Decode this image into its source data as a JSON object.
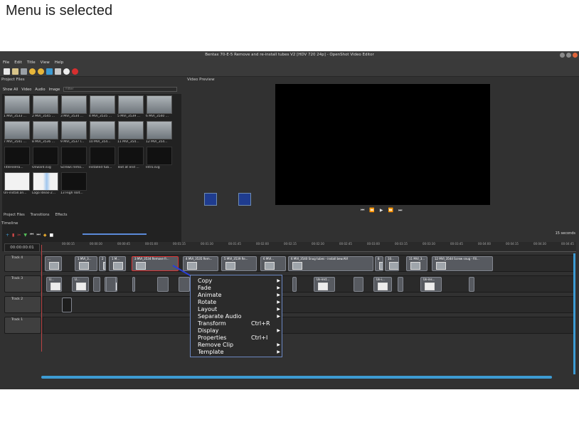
{
  "caption": "Menu is selected",
  "window": {
    "title": "Bentax 70-E-5 Remove and re-install tubes V2 [HDV 720 24p] - OpenShot Video Editor"
  },
  "menu": [
    "File",
    "Edit",
    "Title",
    "View",
    "Help"
  ],
  "panels": {
    "project_files": "Project Files",
    "video_preview": "Video Preview",
    "timeline": "Timeline"
  },
  "filters": [
    "Show All",
    "Video",
    "Audio",
    "Image"
  ],
  "filter_placeholder": "Filter",
  "files": [
    {
      "label": "1 MVI_3533 ...",
      "kind": "gray"
    },
    {
      "label": "2 MVI_3545 ...",
      "kind": "gray"
    },
    {
      "label": "3 MVI_3534 ...",
      "kind": "gray"
    },
    {
      "label": "4 MVI_3535 ...",
      "kind": "gray"
    },
    {
      "label": "5 MVI_3539 ...",
      "kind": "gray"
    },
    {
      "label": "6 MVI_3540 ...",
      "kind": "gray"
    },
    {
      "label": "7 MVI_3541 ...",
      "kind": "gray"
    },
    {
      "label": "8 MVI_3536 ...",
      "kind": "gray"
    },
    {
      "label": "9 MVI_3537 l...",
      "kind": "gray"
    },
    {
      "label": "10 MVI_354...",
      "kind": "gray"
    },
    {
      "label": "11 MVI_354...",
      "kind": "gray"
    },
    {
      "label": "12 MVI_354...",
      "kind": "gray"
    },
    {
      "label": "TitleFileHa...",
      "kind": "dark"
    },
    {
      "label": "Onward.svg",
      "kind": "dark"
    },
    {
      "label": "Screws remo...",
      "kind": "dark"
    },
    {
      "label": "Installed tub...",
      "kind": "dark"
    },
    {
      "label": "Text at end ...",
      "kind": "dark"
    },
    {
      "label": "Intro.svg",
      "kind": "dark"
    },
    {
      "label": "Un-install.an...",
      "kind": "white"
    },
    {
      "label": "Logo Ideas-2...",
      "kind": "blue"
    },
    {
      "label": "13 High Volt...",
      "kind": "dark"
    }
  ],
  "bottom_tabs": [
    "Project Files",
    "Transitions",
    "Effects"
  ],
  "transport": [
    "⏮",
    "⏪",
    "▶",
    "⏩",
    "⏭"
  ],
  "timeline": {
    "timecode": "00:00:00:01",
    "zoom_label": "15 seconds",
    "ticks": [
      "00:00:15",
      "00:00:30",
      "00:00:45",
      "00:01:00",
      "00:01:15",
      "00:01:30",
      "00:01:45",
      "00:02:00",
      "00:02:15",
      "00:02:30",
      "00:02:45",
      "00:03:00",
      "00:03:15",
      "00:03:30",
      "00:03:45",
      "00:04:00",
      "00:04:15",
      "00:04:30",
      "00:04:45"
    ],
    "tracks": [
      "Track 4",
      "Track 3",
      "Track 2",
      "Track 1"
    ],
    "track4_clips": [
      "...",
      "1 MVI_3...",
      "2",
      "1 M...",
      "3 MVI_3534 Remove fr...",
      "4 MVI_3535 Rem...",
      "5 MVI_3539 Re...",
      "6 MVI...",
      "6 MVI_3540 Snug tubes - install bew.AVI",
      "8",
      "10...",
      "11 MVI_3...",
      "12 MVI_3544 Screw snug - fill..."
    ],
    "track3_clips": [
      "U...",
      "U...",
      "U",
      "Un-inst...",
      "Un-i...",
      "Un-ins..."
    ]
  },
  "context_menu": {
    "items": [
      {
        "label": "Copy",
        "shortcut": "",
        "submenu": true
      },
      {
        "label": "Fade",
        "shortcut": "",
        "submenu": true
      },
      {
        "label": "Animate",
        "shortcut": "",
        "submenu": true
      },
      {
        "label": "Rotate",
        "shortcut": "",
        "submenu": true
      },
      {
        "label": "Layout",
        "shortcut": "",
        "submenu": true
      },
      {
        "label": "Separate Audio",
        "shortcut": "",
        "submenu": true
      },
      {
        "label": "Transform",
        "shortcut": "Ctrl+R",
        "submenu": false
      },
      {
        "label": "Display",
        "shortcut": "",
        "submenu": true
      },
      {
        "label": "Properties",
        "shortcut": "Ctrl+I",
        "submenu": false
      },
      {
        "label": "Remove Clip",
        "shortcut": "",
        "submenu": true
      },
      {
        "label": "Template",
        "shortcut": "",
        "submenu": true
      }
    ]
  },
  "colors": {
    "accent": "#3d9bd3",
    "menu_border": "#6b87c2",
    "selected_clip_border": "#dd3333"
  }
}
